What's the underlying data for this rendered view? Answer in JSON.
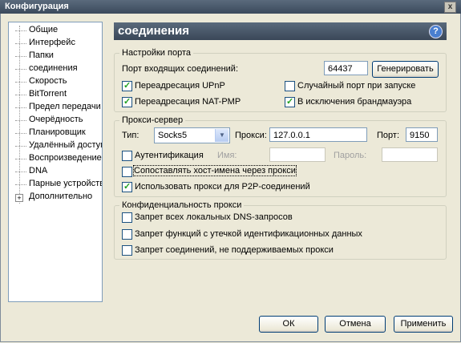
{
  "window": {
    "title": "Конфигурация",
    "close_symbol": "x"
  },
  "sidebar": {
    "items": [
      {
        "label": "Общие"
      },
      {
        "label": "Интерфейс"
      },
      {
        "label": "Папки"
      },
      {
        "label": "соединения"
      },
      {
        "label": "Скорость"
      },
      {
        "label": "BitTorrent"
      },
      {
        "label": "Предел передачи"
      },
      {
        "label": "Очерёдность"
      },
      {
        "label": "Планировщик"
      },
      {
        "label": "Удалённый доступ"
      },
      {
        "label": "Воспроизведение"
      },
      {
        "label": "DNA"
      },
      {
        "label": "Парные устройства"
      },
      {
        "label": "Дополнительно",
        "expander": "+"
      }
    ]
  },
  "header": {
    "title": "соединения",
    "help_symbol": "?"
  },
  "port_settings": {
    "legend": "Настройки порта",
    "incoming_label": "Порт входящих соединений:",
    "port_value": "64437",
    "generate_label": "Генерировать",
    "upnp_label": "Переадресация UPnP",
    "upnp_checked": true,
    "natpmp_label": "Переадресация NAT-PMP",
    "natpmp_checked": true,
    "random_port_label": "Случайный порт при запуске",
    "random_port_checked": false,
    "firewall_label": "В исключения брандмауэра",
    "firewall_checked": true
  },
  "proxy": {
    "legend": "Прокси-сервер",
    "type_label": "Тип:",
    "type_value": "Socks5",
    "proxy_label": "Прокси:",
    "proxy_value": "127.0.0.1",
    "port_label": "Порт:",
    "port_value": "9150",
    "auth_label": "Аутентификация",
    "auth_checked": false,
    "name_label": "Имя:",
    "password_label": "Пароль:",
    "resolve_hostnames_label": "Сопоставлять хост-имена через прокси",
    "resolve_hostnames_checked": false,
    "p2p_label": "Использовать прокси для P2P-соединений",
    "p2p_checked": true
  },
  "privacy": {
    "legend": "Конфиденциальность прокси",
    "dns_label": "Запрет всех локальных DNS-запросов",
    "dns_checked": false,
    "leak_label": "Запрет функций с утечкой идентификационных данных",
    "leak_checked": false,
    "unsupported_label": "Запрет соединений, не поддерживаемых прокси",
    "unsupported_checked": false
  },
  "footer": {
    "ok_label": "ОК",
    "cancel_label": "Отмена",
    "apply_label": "Применить"
  },
  "colors": {
    "header_bg": "#44536a",
    "help_icon": "#4a7fd0",
    "check_mark": "#21a121",
    "window_bg": "#ece9d8"
  }
}
